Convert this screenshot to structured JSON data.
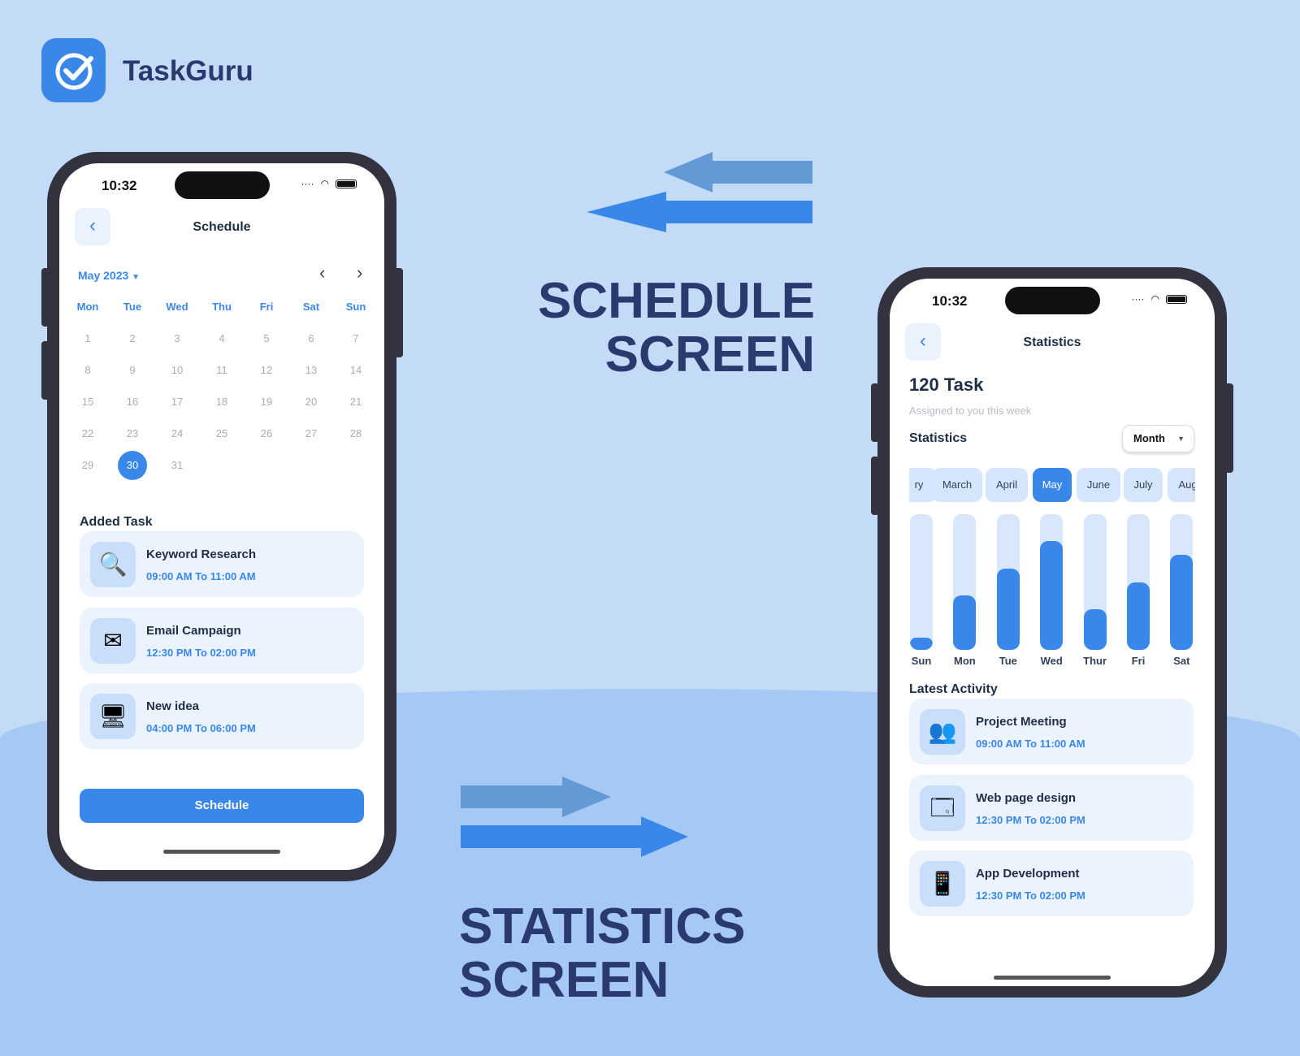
{
  "brand": {
    "name": "TaskGuru",
    "accent": "#3a87ea"
  },
  "captions": {
    "schedule": [
      "SCHEDULE",
      "SCREEN"
    ],
    "statistics": [
      "STATISTICS",
      "SCREEN"
    ]
  },
  "schedule_screen": {
    "status_time": "10:32",
    "title": "Schedule",
    "month_label": "May 2023",
    "weekdays": [
      "Mon",
      "Tue",
      "Wed",
      "Thu",
      "Fri",
      "Sat",
      "Sun"
    ],
    "days_in_month": 31,
    "selected_day": "30",
    "added_task_heading": "Added Task",
    "tasks": [
      {
        "name": "Keyword Research",
        "time": "09:00 AM To 11:00 AM",
        "icon": "magnifier-icon"
      },
      {
        "name": "Email Campaign",
        "time": "12:30 PM To 02:00 PM",
        "icon": "email-icon"
      },
      {
        "name": "New idea",
        "time": "04:00 PM To 06:00 PM",
        "icon": "devices-icon"
      }
    ],
    "schedule_button": "Schedule"
  },
  "statistics_screen": {
    "status_time": "10:32",
    "title": "Statistics",
    "task_count": "120 Task",
    "subtitle": "Assigned to you this week",
    "stats_heading": "Statistics",
    "period_select": "Month",
    "months": [
      "ry",
      "March",
      "April",
      "May",
      "June",
      "July",
      "Aug"
    ],
    "selected_month": "May",
    "latest_heading": "Latest Activity",
    "activities": [
      {
        "name": "Project Meeting",
        "time": "09:00 AM To 11:00 AM",
        "icon": "meeting-icon"
      },
      {
        "name": "Web page design",
        "time": "12:30 PM To 02:00 PM",
        "icon": "webpage-icon"
      },
      {
        "name": "App Development",
        "time": "12:30 PM To 02:00 PM",
        "icon": "phone-app-icon"
      }
    ]
  },
  "chart_data": {
    "type": "bar",
    "categories": [
      "Sun",
      "Mon",
      "Tue",
      "Wed",
      "Thur",
      "Fri",
      "Sat"
    ],
    "values": [
      0.09,
      0.4,
      0.6,
      0.8,
      0.3,
      0.5,
      0.7
    ],
    "ylim": [
      0,
      1
    ]
  }
}
